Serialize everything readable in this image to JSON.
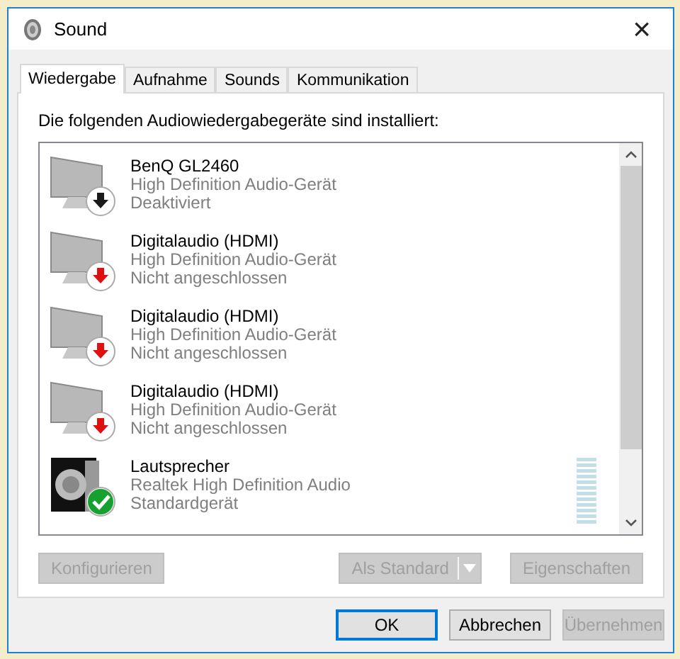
{
  "window": {
    "title": "Sound",
    "close": "×"
  },
  "tabs": [
    {
      "label": "Wiedergabe",
      "selected": true
    },
    {
      "label": "Aufnahme",
      "selected": false
    },
    {
      "label": "Sounds",
      "selected": false
    },
    {
      "label": "Kommunikation",
      "selected": false
    }
  ],
  "intro": "Die folgenden Audiowiedergabegeräte sind installiert:",
  "devices": [
    {
      "kind": "monitor_disabled",
      "name": "BenQ GL2460",
      "driver": "High Definition Audio-Gerät",
      "state": "Deaktiviert"
    },
    {
      "kind": "monitor_unplugged",
      "name": "Digitalaudio (HDMI)",
      "driver": "High Definition Audio-Gerät",
      "state": "Nicht angeschlossen"
    },
    {
      "kind": "monitor_unplugged",
      "name": "Digitalaudio (HDMI)",
      "driver": "High Definition Audio-Gerät",
      "state": "Nicht angeschlossen"
    },
    {
      "kind": "monitor_unplugged",
      "name": "Digitalaudio (HDMI)",
      "driver": "High Definition Audio-Gerät",
      "state": "Nicht angeschlossen"
    },
    {
      "kind": "speaker_default",
      "name": "Lautsprecher",
      "driver": "Realtek High Definition Audio",
      "state": "Standardgerät"
    }
  ],
  "panel_buttons": [
    {
      "label": "Konfigurieren",
      "kind": "plain",
      "disabled": true
    },
    {
      "label": "Als Standard",
      "kind": "split",
      "disabled": true
    },
    {
      "label": "Eigenschaften",
      "kind": "plain",
      "disabled": true
    }
  ],
  "dialog_buttons": [
    {
      "label": "OK",
      "disabled": false,
      "default": true
    },
    {
      "label": "Abbrechen",
      "disabled": false,
      "default": false
    },
    {
      "label": "Übernehmen",
      "disabled": true,
      "default": false
    }
  ]
}
